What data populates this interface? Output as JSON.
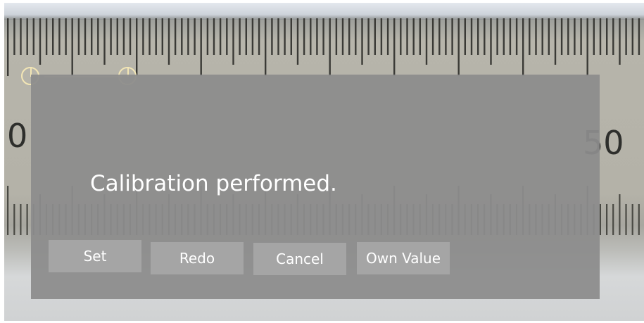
{
  "camera": {
    "ruler_labels": [
      "0",
      "50"
    ]
  },
  "dialog": {
    "message": "Calibration performed.",
    "buttons": {
      "set": "Set",
      "redo": "Redo",
      "cancel": "Cancel",
      "own_value": "Own Value"
    }
  }
}
